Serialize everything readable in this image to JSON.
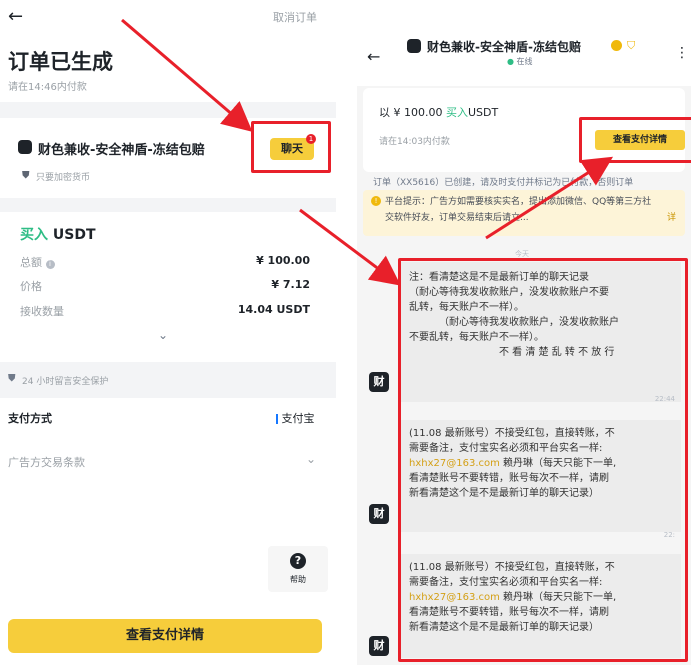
{
  "left": {
    "back_glyph": "←",
    "cancel": "取消订单",
    "title": "订单已生成",
    "pay_within": "请在14:46内付款",
    "merchant": "财色兼收-安全神盾-冻结包赔",
    "chat": "聊天",
    "chat_badge": "1",
    "verified": "只要加密货币",
    "buy": "买入",
    "asset": "USDT",
    "rows": [
      {
        "label": "总额",
        "value": "¥ 100.00"
      },
      {
        "label": "价格",
        "value": "¥ 7.12"
      },
      {
        "label": "接收数量",
        "value": "14.04 USDT"
      }
    ],
    "protection": "24 小时留言安全保护",
    "pay_method_label": "支付方式",
    "pay_method_value": "支付宝",
    "terms": "广告方交易条款",
    "help": "帮助",
    "view_details": "查看支付详情"
  },
  "right": {
    "back_glyph": "←",
    "merchant": "财色兼收-安全神盾-冻结包赔",
    "status": "在线",
    "more": "⋮",
    "buy_line_prefix": "以 ¥ 100.00 ",
    "buy_word": "买入",
    "buy_asset": "USDT",
    "pay_within": "请在14:03内付款",
    "view_details": "查看支付详情",
    "order_note": "订单（XX5616）已创建，请及时支付并标记为已付款，否则订单",
    "notice": "平台提示：广告方如需要核实实名，提出添加微信、QQ等第三方社交软件好友，订单交易结束后请立...",
    "notice_more": "详",
    "today": "今天",
    "avatar_char": "财",
    "msg1": {
      "l1": "注：看清楚这是不是最新订单的聊天记录",
      "l2": "（耐心等待我发收款账户，没发收款账户不要",
      "l3": "乱转，每天账户不一样）。",
      "l4": "（耐心等待我发收款账户，没发收款账户",
      "l5": "不要乱转，每天账户不一样）。",
      "l6": "不 看 清 楚 乱 转 不 放 行",
      "time": "22:44"
    },
    "msg2": {
      "l1": "(11.08 最新账号）不接受红包，直接转账，不",
      "l2": "需要备注，支付宝实名必须和平台实名一样:",
      "email": "hxhx27@163.com",
      "name": " 赖丹琳（每天只能下一单,",
      "l4": "看清楚账号不要转错，账号每次不一样，请刷",
      "l5": "新看清楚这个是不是最新订单的聊天记录）",
      "time": "22:"
    },
    "msg3": {
      "l1": "(11.08 最新账号）不接受红包，直接转账，不",
      "l2": "需要备注，支付宝实名必须和平台实名一样:",
      "email": "hxhx27@163.com",
      "name": " 赖丹琳（每天只能下一单,",
      "l4": "看清楚账号不要转错，账号每次不一样，请刷",
      "l5": "新看清楚这个是不是最新订单的聊天记录）"
    }
  },
  "colors": {
    "accent": "#f6cd3b",
    "red": "#e8202a",
    "green": "#2ebd85"
  }
}
